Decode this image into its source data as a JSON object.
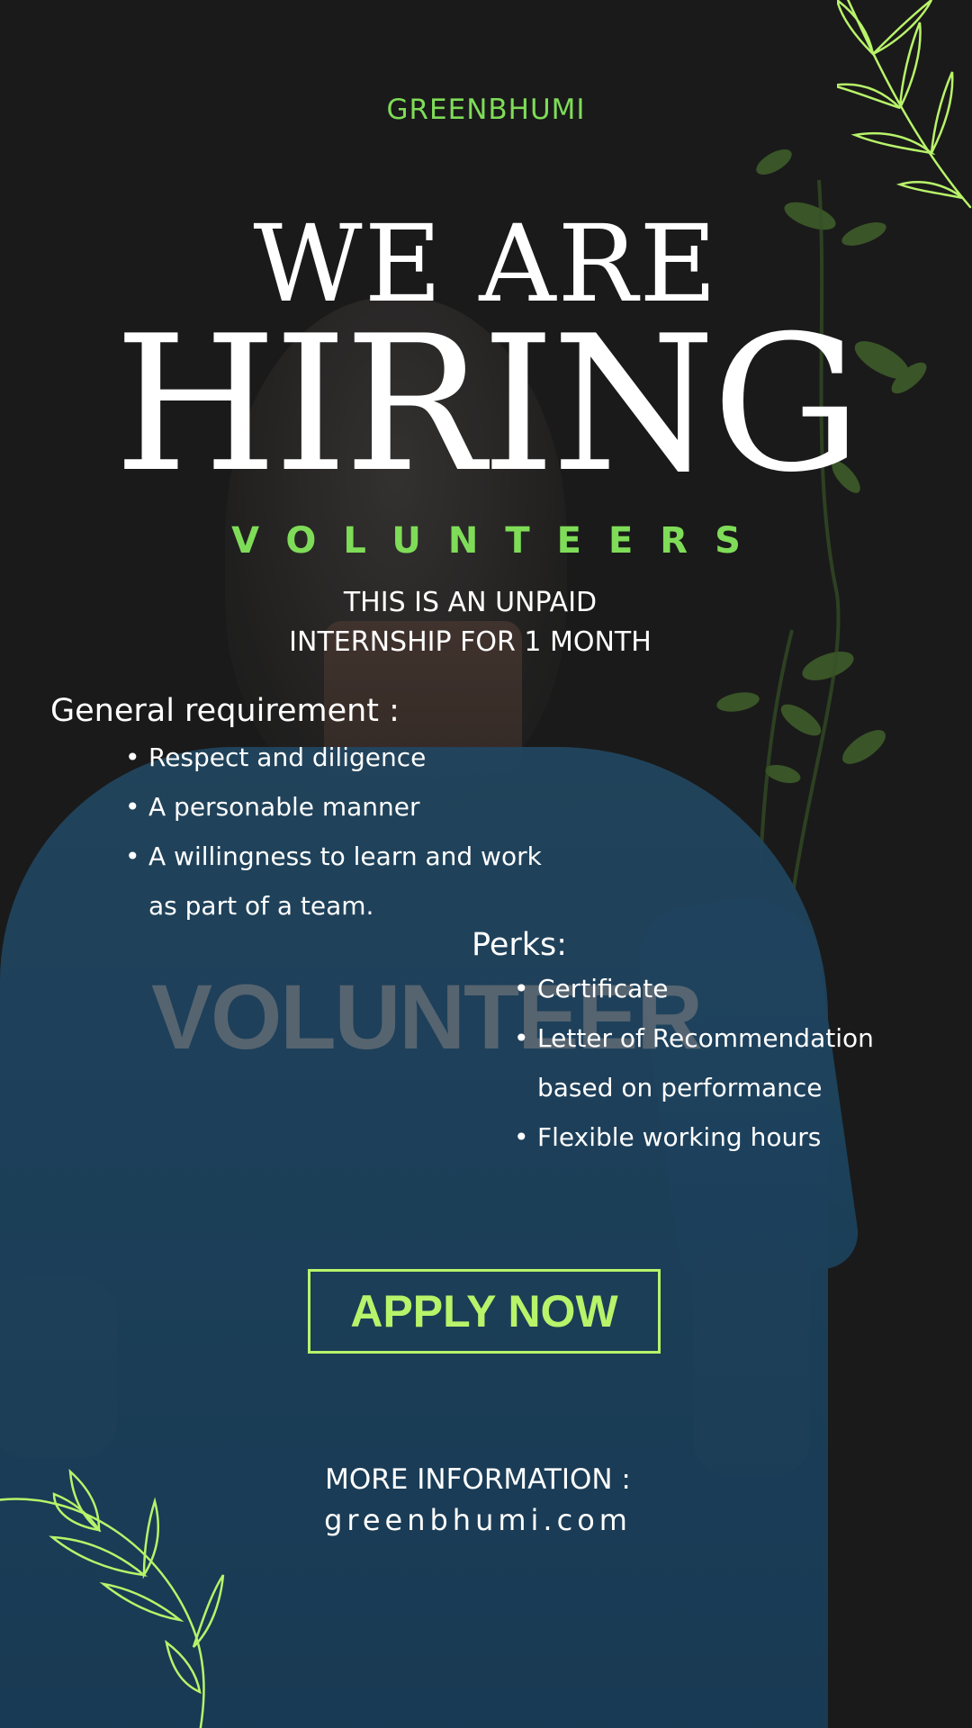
{
  "brand": "GREENBHUMI",
  "headline": {
    "line1": "WE ARE",
    "line2": "HIRING"
  },
  "role": "VOLUNTEERS",
  "subtitle": {
    "line1": "THIS IS AN UNPAID",
    "line2": "INTERNSHIP FOR 1 MONTH"
  },
  "requirements": {
    "title": "General requirement :",
    "items": [
      "Respect and diligence",
      "A personable manner",
      "A willingness to learn and work as part of a team."
    ]
  },
  "perks": {
    "title": "Perks:",
    "items": [
      "Certificate",
      "Letter of Recommendation based on performance",
      "Flexible working hours"
    ]
  },
  "cta": {
    "apply_label": "APPLY NOW"
  },
  "more_info": {
    "label": "MORE INFORMATION :",
    "url": "greenbhumi.com"
  },
  "background": {
    "shirt_print": "VOLUNTEER"
  },
  "colors": {
    "background": "#1b1b1b",
    "accent_green": "#7fdc58",
    "leaf_lime": "#b8f36a",
    "shirt_blue": "#1f4b6c",
    "text": "#ffffff"
  },
  "icons": {
    "top_right": "leaf-branch-icon",
    "bottom_left": "leaf-branch-icon"
  }
}
